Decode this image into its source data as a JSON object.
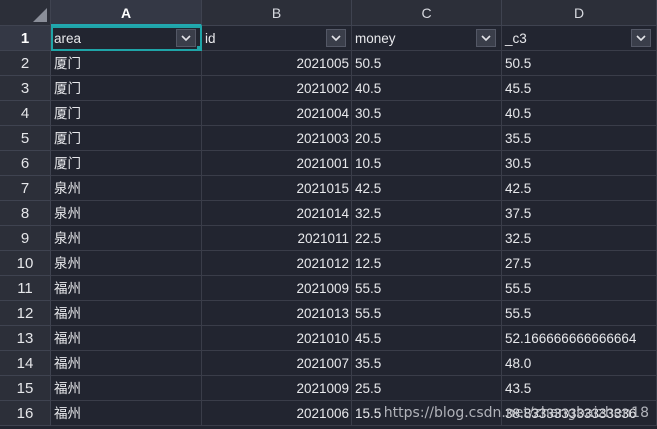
{
  "columns": [
    "A",
    "B",
    "C",
    "D"
  ],
  "header_row_number": "1",
  "headers": [
    "area",
    "id",
    "money",
    "_c3"
  ],
  "rows": [
    {
      "n": "2",
      "area": "厦门",
      "id": "2021005",
      "money": "50.5",
      "c3": "50.5"
    },
    {
      "n": "3",
      "area": "厦门",
      "id": "2021002",
      "money": "40.5",
      "c3": "45.5"
    },
    {
      "n": "4",
      "area": "厦门",
      "id": "2021004",
      "money": "30.5",
      "c3": "40.5"
    },
    {
      "n": "5",
      "area": "厦门",
      "id": "2021003",
      "money": "20.5",
      "c3": "35.5"
    },
    {
      "n": "6",
      "area": "厦门",
      "id": "2021001",
      "money": "10.5",
      "c3": "30.5"
    },
    {
      "n": "7",
      "area": "泉州",
      "id": "2021015",
      "money": "42.5",
      "c3": "42.5"
    },
    {
      "n": "8",
      "area": "泉州",
      "id": "2021014",
      "money": "32.5",
      "c3": "37.5"
    },
    {
      "n": "9",
      "area": "泉州",
      "id": "2021011",
      "money": "22.5",
      "c3": "32.5"
    },
    {
      "n": "10",
      "area": "泉州",
      "id": "2021012",
      "money": "12.5",
      "c3": "27.5"
    },
    {
      "n": "11",
      "area": "福州",
      "id": "2021009",
      "money": "55.5",
      "c3": "55.5"
    },
    {
      "n": "12",
      "area": "福州",
      "id": "2021013",
      "money": "55.5",
      "c3": "55.5"
    },
    {
      "n": "13",
      "area": "福州",
      "id": "2021010",
      "money": "45.5",
      "c3": "52.166666666666664"
    },
    {
      "n": "14",
      "area": "福州",
      "id": "2021007",
      "money": "35.5",
      "c3": "48.0"
    },
    {
      "n": "15",
      "area": "福州",
      "id": "2021009",
      "money": "25.5",
      "c3": "43.5"
    },
    {
      "n": "16",
      "area": "福州",
      "id": "2021006",
      "money": "15.5",
      "c3": "38.833333333333336"
    }
  ],
  "watermark": "https://blog.csdn.net/zhangbaizhen18",
  "colors": {
    "selection": "#1fa5a8",
    "background": "#222530",
    "header_bg": "#2c2f39"
  },
  "icons": {
    "corner": "select-all-triangle",
    "filter": "chevron-down-icon"
  }
}
